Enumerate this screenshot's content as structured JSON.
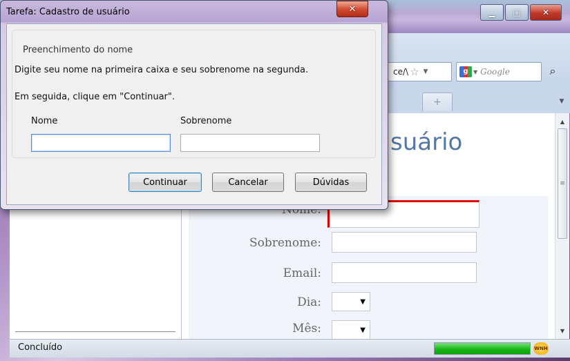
{
  "browser": {
    "address_text": "ce/\\",
    "search_placeholder": "Google",
    "page_heading": "suário",
    "form_rows": [
      {
        "label": "Nome:"
      },
      {
        "label": "Sobrenome:"
      },
      {
        "label": "Email:"
      },
      {
        "label": "Dia:"
      },
      {
        "label": "Mês:"
      }
    ],
    "status_text": "Concluído",
    "progress_percent": 100,
    "status_badge": "WNH"
  },
  "dialog": {
    "title": "Tarefa: Cadastro de usuário",
    "group_title": "Preenchimento do nome",
    "instruction_1": "Digite seu nome na primeira caixa e seu sobrenome na segunda.",
    "instruction_2": "Em seguida, clique em \"Continuar\".",
    "first_name_label": "Nome",
    "first_name_value": "",
    "last_name_label": "Sobrenome",
    "last_name_value": "",
    "buttons": {
      "continue": "Continuar",
      "cancel": "Cancelar",
      "help": "Dúvidas"
    }
  },
  "colors": {
    "heading": "#5577a8",
    "progress": "#18b818",
    "close_button": "#cf4a30"
  }
}
